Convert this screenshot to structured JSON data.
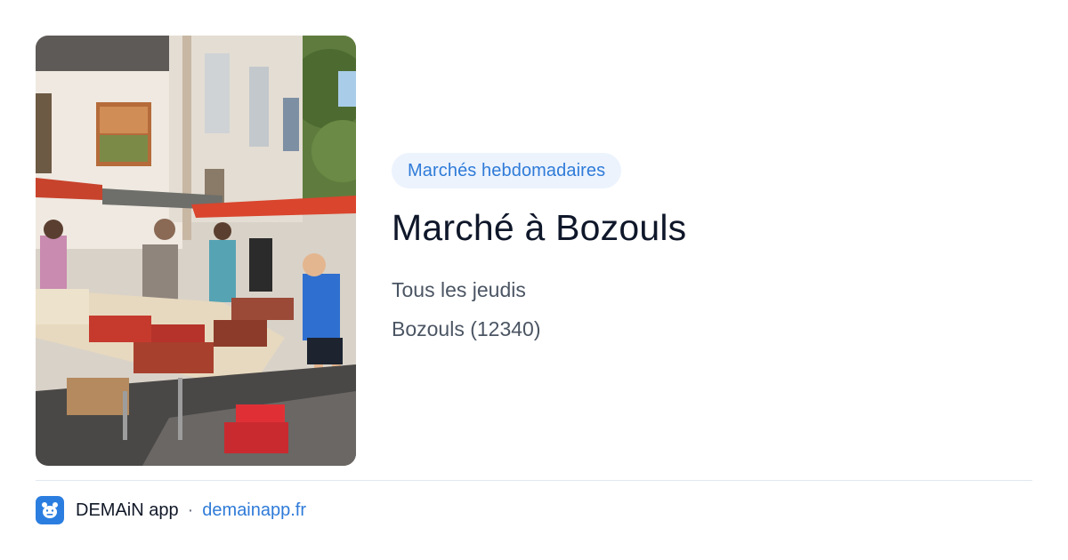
{
  "card": {
    "category": "Marchés hebdomadaires",
    "title": "Marché à Bozouls",
    "schedule": "Tous les jeudis",
    "location": "Bozouls (12340)"
  },
  "image": {
    "icon": "market-photo"
  },
  "footer": {
    "app_name": "DEMAiN app",
    "separator": "·",
    "site": "demainapp.fr",
    "app_icon": "demain-app-icon"
  },
  "colors": {
    "accent": "#2f7bd8",
    "badge_bg": "#ecf3fd",
    "title": "#0f172a",
    "body_text": "#4b5563",
    "divider": "#e2e8f0",
    "app_icon_bg": "#2b7ee0"
  }
}
